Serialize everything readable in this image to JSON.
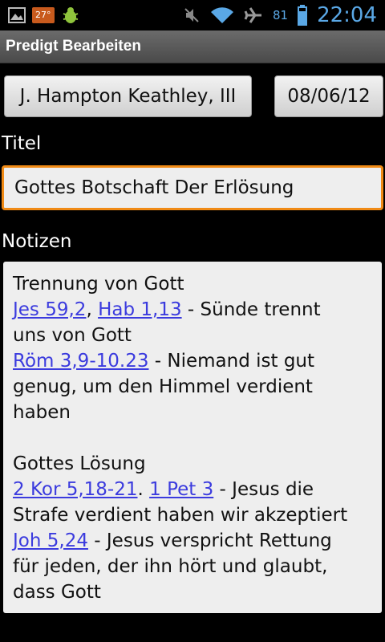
{
  "statusbar": {
    "temperature": "27°",
    "battery": "81",
    "time": "22:04",
    "icons": [
      "image-icon",
      "temperature-icon",
      "bug-icon",
      "mute-icon",
      "wifi-icon",
      "airplane-icon",
      "battery-icon"
    ]
  },
  "titlebar": {
    "title": "Predigt Bearbeiten"
  },
  "buttons": {
    "author": "J. Hampton Keathley, III",
    "date": "08/06/12"
  },
  "labels": {
    "title": "Titel",
    "notes": "Notizen"
  },
  "title_value": "Gottes Botschaft Der Erlösung",
  "notes": {
    "p1_heading": "Trennung von Gott",
    "ref1a": "Jes 59,2",
    "sep1": ", ",
    "ref1b": "Hab 1,13",
    "text1a": " - Sünde trennt",
    "text1b": "uns von Gott",
    "ref2": "Röm 3,9-10.23",
    "text2a": " - Niemand ist gut",
    "text2b": "genug, um den Himmel verdient",
    "text2c": "haben",
    "p2_heading": "Gottes Lösung",
    "ref3a": "2 Kor 5,18-21",
    "sep3": ". ",
    "ref3b": "1 Pet 3",
    "text3a": " - Jesus die",
    "text3b": "Strafe verdient haben wir akzeptiert",
    "ref4": "Joh 5,24",
    "text4a": " - Jesus verspricht Rettung",
    "text4b": "für jeden, der ihn hört und glaubt,",
    "text4c": "dass Gott"
  },
  "colors": {
    "accent": "#f08a15",
    "link": "#3b3bde",
    "clock": "#5aa8e6"
  }
}
